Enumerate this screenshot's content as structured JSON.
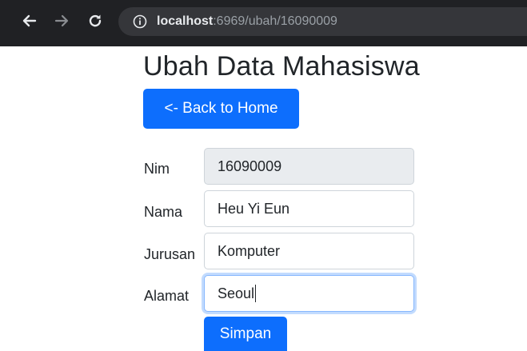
{
  "browser": {
    "url_host": "localhost",
    "url_rest": ":6969/ubah/16090009"
  },
  "page": {
    "title": "Ubah Data Mahasiswa",
    "back_button": "<- Back to Home"
  },
  "form": {
    "nim_label": "Nim",
    "nim_value": "16090009",
    "nama_label": "Nama",
    "nama_value": "Heu Yi Eun",
    "jurusan_label": "Jurusan",
    "jurusan_value": "Komputer",
    "alamat_label": "Alamat",
    "alamat_value": "Seoul",
    "submit_label": "Simpan"
  },
  "colors": {
    "primary": "#0d6efd",
    "browser_chrome": "#202124",
    "readonly_input": "#e9ecef"
  },
  "icons": [
    "back-arrow-icon",
    "forward-arrow-icon",
    "reload-icon",
    "info-icon"
  ]
}
